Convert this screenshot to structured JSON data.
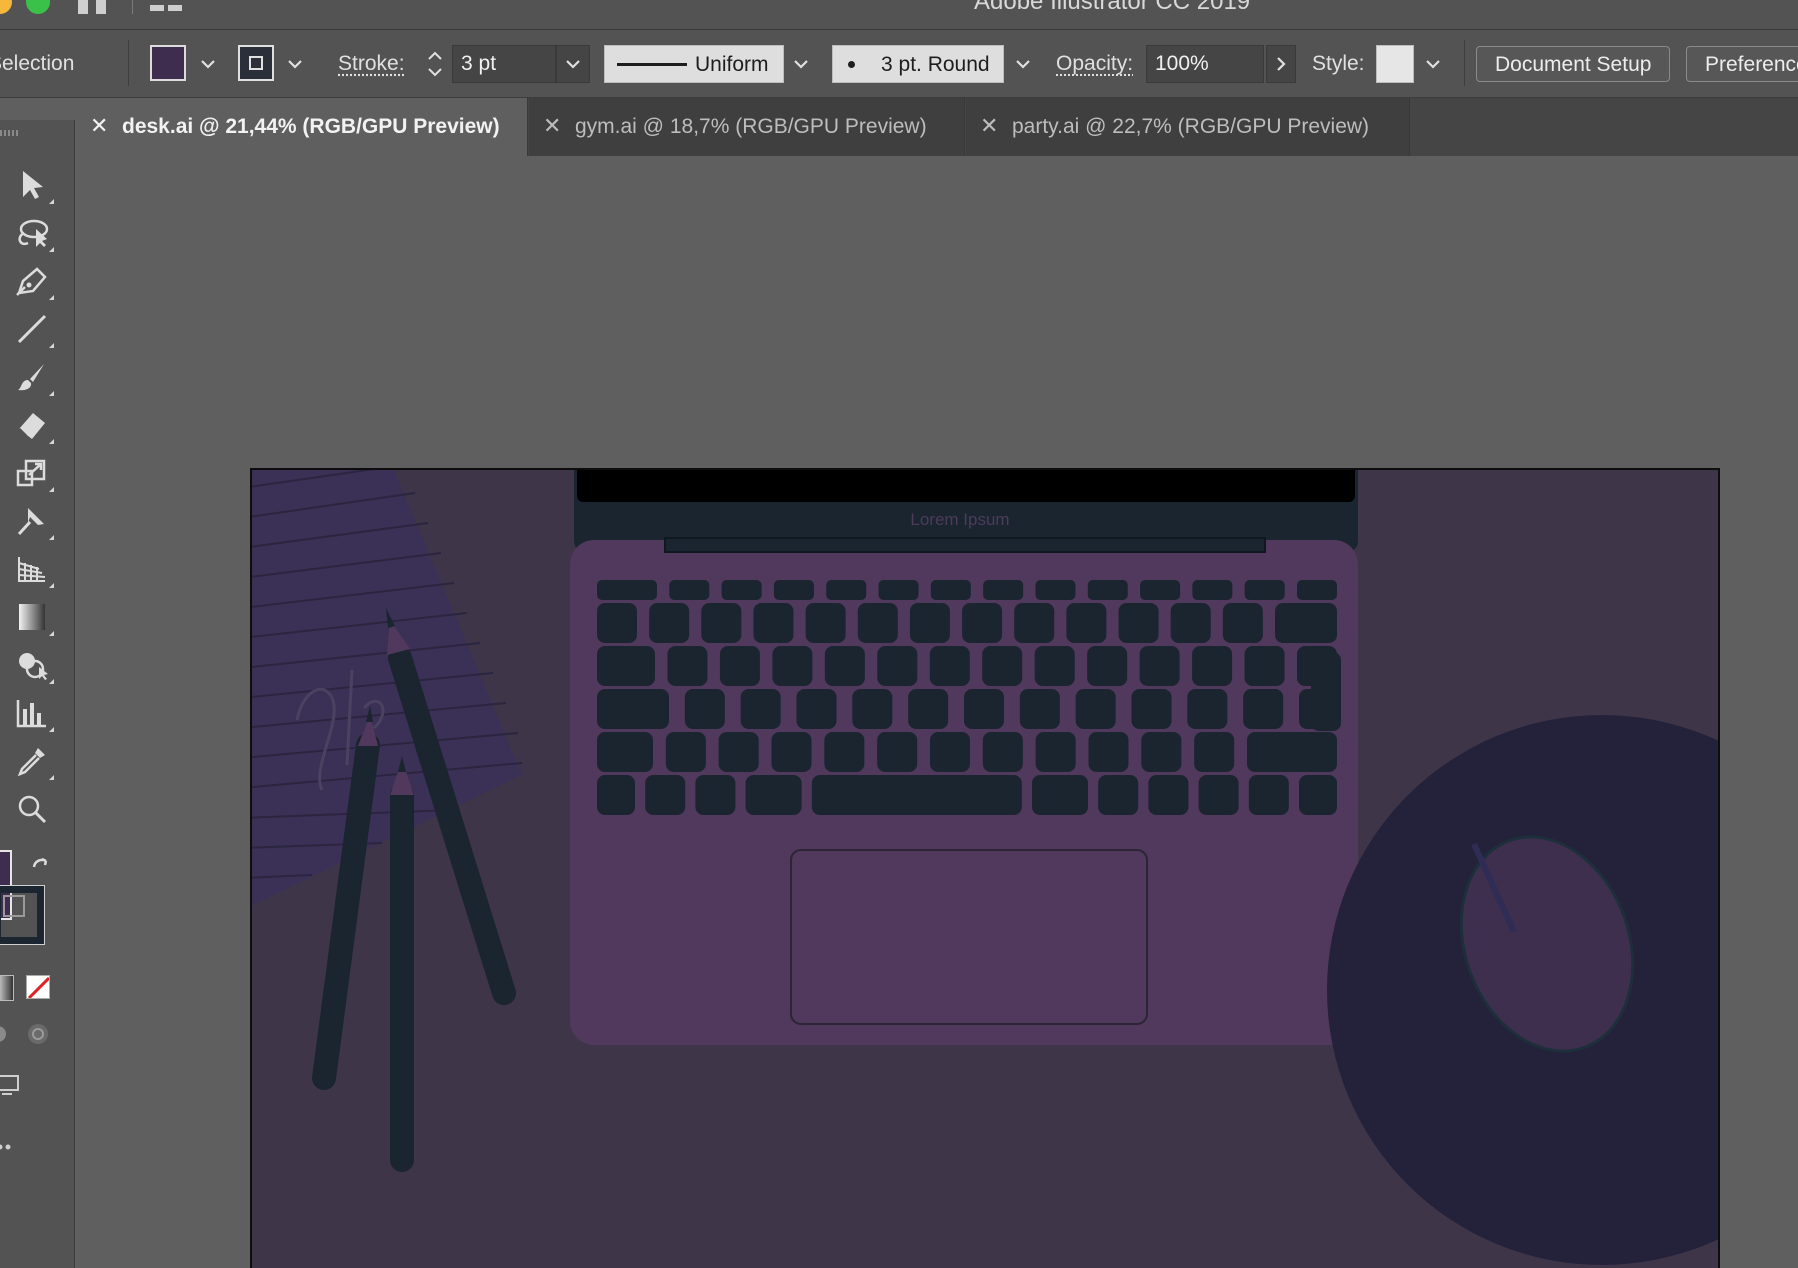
{
  "app": {
    "title": "Adobe Illustrator CC 2019"
  },
  "controlbar": {
    "selection_label": "Selection",
    "fill_color": "#3f2d4f",
    "stroke_label": "Stroke:",
    "stroke_weight": "3 pt",
    "stroke_profile": "Uniform",
    "brush": "3 pt. Round",
    "opacity_label": "Opacity:",
    "opacity_value": "100%",
    "style_label": "Style:",
    "document_setup_label": "Document Setup",
    "preferences_label": "Preferences"
  },
  "tabs": [
    {
      "label": "desk.ai @ 21,44% (RGB/GPU Preview)",
      "active": true
    },
    {
      "label": "gym.ai @ 18,7% (RGB/GPU Preview)",
      "active": false
    },
    {
      "label": "party.ai @ 22,7% (RGB/GPU Preview)",
      "active": false
    }
  ],
  "toolbar": {
    "tools": [
      "selection-tool-icon",
      "lasso-tool-icon",
      "pen-tool-icon",
      "line-tool-icon",
      "paintbrush-tool-icon",
      "eraser-tool-icon",
      "scale-tool-icon",
      "puppet-warp-tool-icon",
      "perspective-grid-tool-icon",
      "gradient-tool-icon",
      "shape-builder-tool-icon",
      "graph-tool-icon",
      "eyedropper-tool-icon",
      "zoom-tool-icon"
    ]
  },
  "artwork": {
    "screen_text": "Lorem Ipsum",
    "colors": {
      "background": "#3e3549",
      "laptop_body": "#51385d",
      "keys": "#1a2530",
      "mousepad": "#24213b",
      "mouse": "#3d2f4d",
      "notebook": "#3b3156",
      "pencil": "#1a2530"
    }
  }
}
